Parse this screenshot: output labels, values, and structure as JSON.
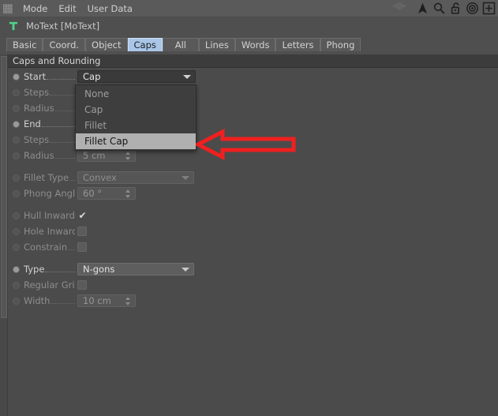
{
  "menubar": {
    "grip_icon": "grid-handle-icon",
    "items": [
      {
        "label": "Mode"
      },
      {
        "label": "Edit"
      },
      {
        "label": "User Data"
      }
    ],
    "icons": [
      {
        "name": "eye-wireframe-icon",
        "title": "Preview"
      },
      {
        "name": "cursor-arrow-icon",
        "title": "Pick"
      },
      {
        "name": "magnifier-icon",
        "title": "Search"
      },
      {
        "name": "unlock-padlock-icon",
        "title": "Lock"
      },
      {
        "name": "target-circle-icon",
        "title": "Target"
      },
      {
        "name": "plus-box-icon",
        "title": "Add"
      }
    ]
  },
  "object": {
    "icon": "motext-t-icon",
    "icon_color": "#4fd48a",
    "title": "MoText [MoText]"
  },
  "tabs": {
    "items": [
      {
        "label": "Basic",
        "active": false
      },
      {
        "label": "Coord.",
        "active": false
      },
      {
        "label": "Object",
        "active": false
      },
      {
        "label": "Caps",
        "active": true
      },
      {
        "label": "All",
        "active": false
      },
      {
        "label": "Lines",
        "active": false
      },
      {
        "label": "Words",
        "active": false
      },
      {
        "label": "Letters",
        "active": false
      },
      {
        "label": "Phong",
        "active": false
      }
    ],
    "active_color": "#a9c6e8"
  },
  "panel": {
    "group_title": "Caps and Rounding",
    "rows": [
      {
        "label": "Start",
        "leader": ". . . . . . .",
        "enabled": true,
        "control": "combo",
        "value": "Cap",
        "open": true
      },
      {
        "label": "Steps",
        "leader": ". . . . . .",
        "enabled": false,
        "control": "number",
        "value": "",
        "open": false
      },
      {
        "label": "Radius",
        "leader": ". . . . .",
        "enabled": false,
        "control": "number",
        "value": "",
        "open": false
      },
      {
        "label": "End",
        "leader": ". . . . . . .",
        "enabled": true,
        "control": "combo",
        "value": "",
        "open": false
      },
      {
        "label": "Steps",
        "leader": ". . . . . .",
        "enabled": false,
        "control": "number",
        "value": "",
        "open": false
      },
      {
        "label": "Radius",
        "leader": ". . . . .",
        "enabled": false,
        "control": "number",
        "value": "5 cm",
        "open": false
      },
      {
        "label": "Fillet Type",
        "leader": ". . .",
        "enabled": false,
        "control": "combo",
        "value": "Convex",
        "open": false
      },
      {
        "label": "Phong Angle",
        "leader": "",
        "enabled": false,
        "control": "number",
        "value": "60 °",
        "open": false
      },
      {
        "label": "Hull Inwards",
        "leader": "",
        "enabled": false,
        "control": "check",
        "value": "checked",
        "open": false
      },
      {
        "label": "Hole Inwards",
        "leader": "",
        "enabled": false,
        "control": "check",
        "value": "",
        "open": false
      },
      {
        "label": "Constrain",
        "leader": ". . .",
        "enabled": false,
        "control": "check",
        "value": "",
        "open": false
      },
      {
        "label": "Type",
        "leader": ". . . . . . .",
        "enabled": true,
        "control": "combo",
        "value": "N-gons",
        "open": false
      },
      {
        "label": "Regular Grid",
        "leader": "",
        "enabled": false,
        "control": "check",
        "value": "",
        "open": false
      },
      {
        "label": "Width",
        "leader": ". . . . . .",
        "enabled": false,
        "control": "number",
        "value": "10 cm",
        "open": false
      }
    ]
  },
  "dropdown": {
    "name": "start-cap-dropdown",
    "selected": "Fillet Cap",
    "options": [
      {
        "label": "None",
        "selected": false
      },
      {
        "label": "Cap",
        "selected": false
      },
      {
        "label": "Fillet",
        "selected": false
      },
      {
        "label": "Fillet Cap",
        "selected": true
      }
    ]
  },
  "annotation": {
    "name": "red-arrow-annotation",
    "shape": "hollow-left-arrow",
    "color": "#ef2020"
  }
}
